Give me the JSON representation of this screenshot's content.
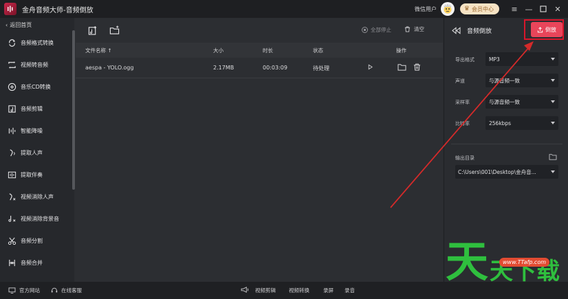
{
  "app": {
    "title": "金舟音频大师-音频倒放"
  },
  "titlebar": {
    "user_label": "微信用户",
    "vip_label": "会员中心"
  },
  "sidebar": {
    "back_label": "返回首页",
    "items": [
      {
        "label": "音频格式转换",
        "icon": "format-convert-icon"
      },
      {
        "label": "视频转音频",
        "icon": "video-to-audio-icon"
      },
      {
        "label": "音乐CD转换",
        "icon": "cd-icon"
      },
      {
        "label": "音频剪辑",
        "icon": "audio-edit-icon"
      },
      {
        "label": "智能降噪",
        "icon": "noise-reduce-icon"
      },
      {
        "label": "提取人声",
        "icon": "extract-vocal-icon"
      },
      {
        "label": "提取伴奏",
        "icon": "extract-accompaniment-icon"
      },
      {
        "label": "视频消除人声",
        "icon": "video-remove-vocal-icon"
      },
      {
        "label": "视频消除背景音",
        "icon": "video-remove-bg-icon"
      },
      {
        "label": "音频分割",
        "icon": "scissors-icon"
      },
      {
        "label": "音频合并",
        "icon": "merge-icon"
      }
    ]
  },
  "toolbar": {
    "stop_all_label": "全部停止",
    "clear_label": "清空"
  },
  "table": {
    "headers": {
      "name": "文件名称",
      "size": "大小",
      "duration": "时长",
      "status": "状态",
      "actions": "操作"
    },
    "sort_indicator": "↑",
    "rows": [
      {
        "name": "aespa - YOLO.ogg",
        "size": "2.17MB",
        "duration": "00:03:09",
        "status": "待处理"
      }
    ]
  },
  "panel": {
    "title": "音频倒放",
    "reverse_button": "倒放",
    "fields": [
      {
        "label": "导出格式",
        "value": "MP3"
      },
      {
        "label": "声道",
        "value": "与源音频一致"
      },
      {
        "label": "采样率",
        "value": "与源音频一致"
      },
      {
        "label": "比特率",
        "value": "256kbps"
      }
    ],
    "output_dir_label": "输出目录",
    "output_dir_value": "C:\\Users\\001\\Desktop\\金舟音..."
  },
  "bottombar": {
    "website": "官方网站",
    "service": "在线客服",
    "links": [
      "视频剪辑",
      "视频转换",
      "录屏",
      "录音"
    ]
  },
  "watermark": {
    "site": "www.TTafp.com",
    "chars_big": "天",
    "chars_small": "天下载"
  },
  "colors": {
    "accent": "#e8455a",
    "highlight_frame": "#d8162b",
    "background": "#2b2d31",
    "arrow": "#d42a2a",
    "watermark_green": "#2fbf3e"
  }
}
